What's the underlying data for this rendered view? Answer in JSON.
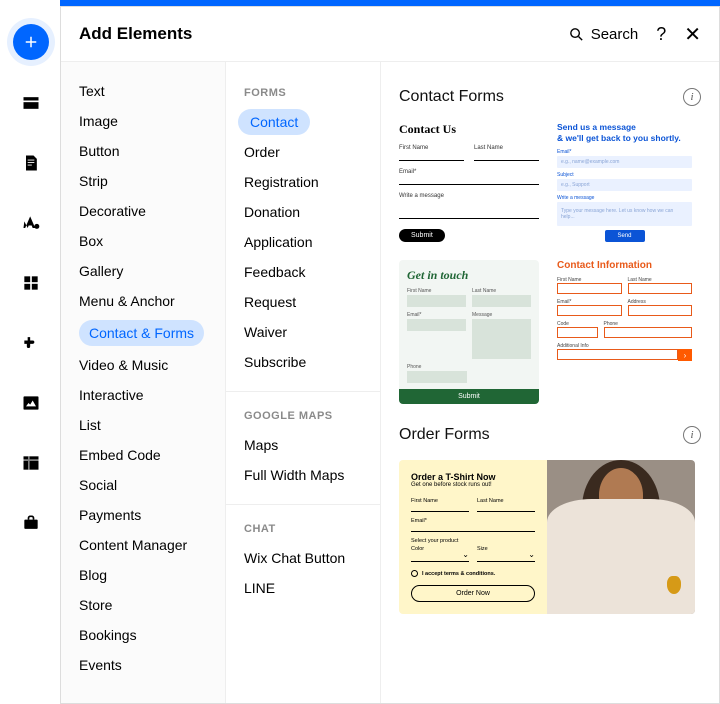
{
  "header": {
    "title": "Add Elements",
    "search_label": "Search"
  },
  "categories": [
    "Text",
    "Image",
    "Button",
    "Strip",
    "Decorative",
    "Box",
    "Gallery",
    "Menu & Anchor",
    "Contact & Forms",
    "Video & Music",
    "Interactive",
    "List",
    "Embed Code",
    "Social",
    "Payments",
    "Content Manager",
    "Blog",
    "Store",
    "Bookings",
    "Events"
  ],
  "active_category_index": 8,
  "subgroups": [
    {
      "heading": "FORMS",
      "items": [
        "Contact",
        "Order",
        "Registration",
        "Donation",
        "Application",
        "Feedback",
        "Request",
        "Waiver",
        "Subscribe"
      ],
      "active_index": 0
    },
    {
      "heading": "GOOGLE MAPS",
      "items": [
        "Maps",
        "Full Width Maps"
      ]
    },
    {
      "heading": "CHAT",
      "items": [
        "Wix Chat Button",
        "LINE"
      ]
    }
  ],
  "sections": [
    {
      "title": "Contact Forms"
    },
    {
      "title": "Order Forms"
    }
  ],
  "templates": {
    "contact_us": {
      "title": "Contact Us",
      "first": "First Name",
      "last": "Last Name",
      "email": "Email*",
      "msg": "Write a message",
      "submit": "Submit"
    },
    "send_msg": {
      "line1": "Send us a message",
      "line2": "& we'll get back to you shortly.",
      "email_lbl": "Email*",
      "email_ph": "e.g., name@example.com",
      "subject_lbl": "Subject",
      "subject_ph": "e.g., Support",
      "write_lbl": "Write a message",
      "area_ph": "Type your message here. Let us know how we can help...",
      "send": "Send"
    },
    "get_in_touch": {
      "title": "Get in touch",
      "first": "First Name",
      "last": "Last Name",
      "email": "Email*",
      "message": "Message",
      "phone": "Phone",
      "submit": "Submit"
    },
    "contact_info": {
      "title": "Contact Information",
      "first": "First Name",
      "last": "Last Name",
      "email": "Email*",
      "address": "Address",
      "code": "Code",
      "phone": "Phone",
      "addl": "Additional Info"
    },
    "order_tshirt": {
      "title": "Order a T-Shirt Now",
      "sub": "Get one before stock runs out!",
      "first": "First Name",
      "last": "Last Name",
      "email": "Email*",
      "select": "Select your product",
      "color": "Color",
      "size": "Size",
      "terms": "I accept terms & conditions.",
      "order": "Order Now"
    }
  }
}
